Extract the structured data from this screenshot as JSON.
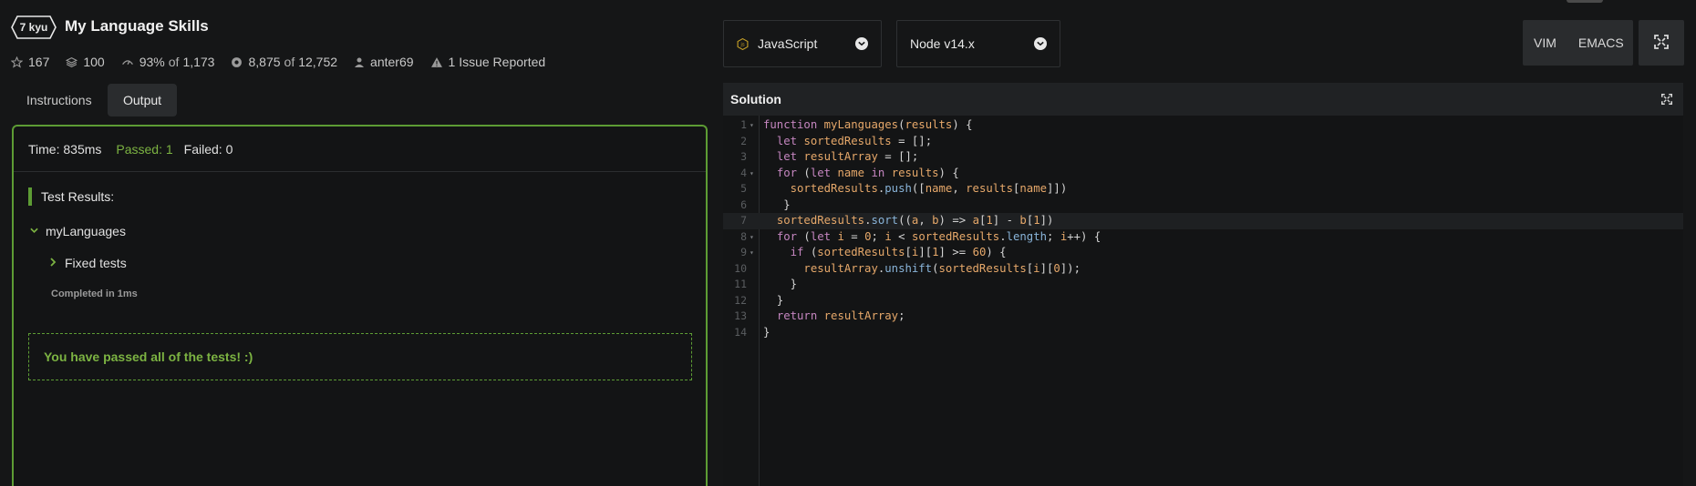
{
  "kata": {
    "rank": "7 kyu",
    "title": "My Language Skills",
    "stats": {
      "stars": "167",
      "collections": "100",
      "satisfaction": "93%",
      "satisfaction_of": "of",
      "satisfaction_total": "1,173",
      "completed": "8,875",
      "completed_of": "of",
      "completed_total": "12,752",
      "author": "anter69",
      "issues": "1 Issue Reported"
    }
  },
  "tabs": [
    {
      "label": "Instructions",
      "active": false
    },
    {
      "label": "Output",
      "active": true
    }
  ],
  "output": {
    "time": "Time: 835ms",
    "passed": "Passed: 1",
    "failed": "Failed: 0",
    "test_results_title": "Test Results:",
    "group_name": "myLanguages",
    "subgroup_name": "Fixed tests",
    "completed_in": "Completed in 1ms",
    "pass_message": "You have passed all of the tests! :)"
  },
  "language_select": {
    "value": "JavaScript"
  },
  "version_select": {
    "value": "Node v14.x"
  },
  "editor_modes": {
    "vim": "VIM",
    "emacs": "EMACS"
  },
  "solution": {
    "title": "Solution",
    "current_line": 7,
    "lines": [
      "function myLanguages(results) {",
      "  let sortedResults = [];",
      "  let resultArray = [];",
      "  for (let name in results) {",
      "    sortedResults.push([name, results[name]])",
      "   }",
      "  sortedResults.sort((a, b) => a[1] - b[1])",
      "  for (let i = 0; i < sortedResults.length; i++) {",
      "    if (sortedResults[i][1] >= 60) {",
      "      resultArray.unshift(sortedResults[i][0]);",
      "    }",
      "  }",
      "  return resultArray;",
      "}"
    ],
    "fold_lines": [
      1,
      4,
      8,
      9
    ]
  },
  "colors": {
    "accent_green": "#5d9c34",
    "passed_text": "#7cb342",
    "background": "#151617"
  },
  "icons": [
    "star-icon",
    "collection-icon",
    "satisfaction-icon",
    "completed-icon",
    "author-icon",
    "warning-icon",
    "javascript-icon",
    "chevron-down-icon",
    "fullscreen-icon",
    "expand-icon"
  ]
}
